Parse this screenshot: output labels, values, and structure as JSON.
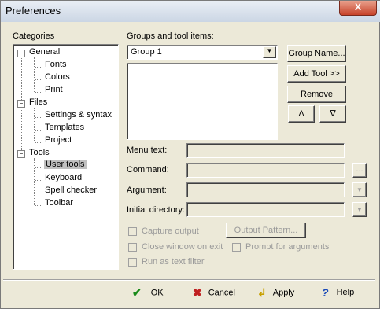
{
  "window": {
    "title": "Preferences",
    "close_glyph": "X"
  },
  "categories": {
    "heading": "Categories",
    "tree": [
      {
        "label": "General",
        "expanded": true,
        "children": [
          "Fonts",
          "Colors",
          "Print"
        ]
      },
      {
        "label": "Files",
        "expanded": true,
        "children": [
          "Settings & syntax",
          "Templates",
          "Project"
        ]
      },
      {
        "label": "Tools",
        "expanded": true,
        "children": [
          "User tools",
          "Keyboard",
          "Spell checker",
          "Toolbar"
        ]
      }
    ],
    "selected": "User tools",
    "expander_glyph": "−"
  },
  "groups": {
    "heading": "Groups and tool items:",
    "selected_group": "Group 1",
    "buttons": {
      "group_name": "Group Name...",
      "add_tool": "Add Tool >>",
      "remove": "Remove",
      "up": "Δ",
      "down": "∇"
    }
  },
  "fields": {
    "menu_text": {
      "label": "Menu text:",
      "value": ""
    },
    "command": {
      "label": "Command:",
      "value": ""
    },
    "argument": {
      "label": "Argument:",
      "value": ""
    },
    "initial_directory": {
      "label": "Initial directory:",
      "value": ""
    },
    "browse_glyph": "...",
    "dropdown_glyph": "▼"
  },
  "options": {
    "capture_output": "Capture output",
    "output_pattern": "Output Pattern...",
    "close_window": "Close window on exit",
    "prompt_args": "Prompt for arguments",
    "text_filter": "Run as text filter"
  },
  "footer": {
    "ok": "OK",
    "cancel": "Cancel",
    "apply": "Apply",
    "help": "Help",
    "icons": {
      "ok": "check-icon",
      "cancel": "cross-icon",
      "apply": "apply-arrow-icon",
      "help": "help-icon"
    },
    "colors": {
      "ok": "#1a8a1a",
      "cancel": "#c02020",
      "apply": "#c8a000",
      "help": "#1a4ab8"
    }
  }
}
